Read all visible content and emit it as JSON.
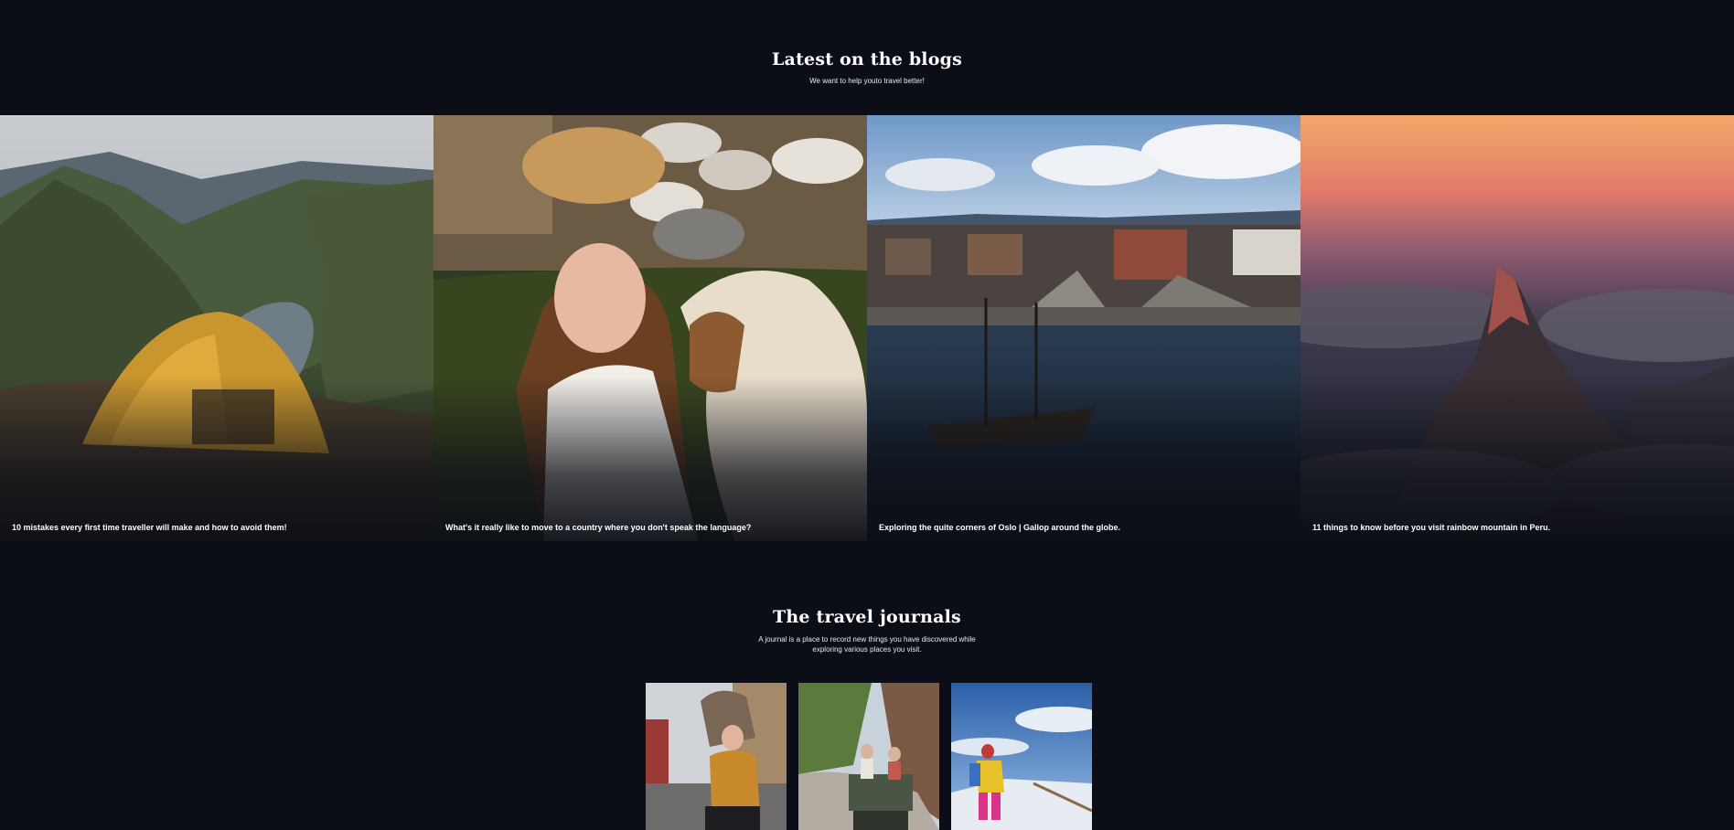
{
  "blogs": {
    "title": "Latest on the blogs",
    "subtitle": "We want to help youto travel better!",
    "posts": [
      {
        "caption": "10 mistakes every first time traveller will make and how to avoid them!",
        "image": "tent-in-mountains"
      },
      {
        "caption": "What's it really like to move to a country where you don't speak the language?",
        "image": "woman-feeding-goat"
      },
      {
        "caption": "Exploring the quite corners of Oslo | Gallop around the globe.",
        "image": "oslo-harbour-ship"
      },
      {
        "caption": "11 things to know before you visit rainbow mountain in Peru.",
        "image": "mountain-peak-sunset"
      }
    ]
  },
  "journals": {
    "title": "The travel journals",
    "subtitle": "A journal is a place to record new things you have discovered while exploring various places you visit.",
    "cards": [
      {
        "image": "traveller-city-street"
      },
      {
        "image": "couple-in-jeep"
      },
      {
        "image": "hiker-snowy-mountain"
      }
    ]
  },
  "colors": {
    "background": "#0b0e16",
    "text": "#ffffff"
  }
}
